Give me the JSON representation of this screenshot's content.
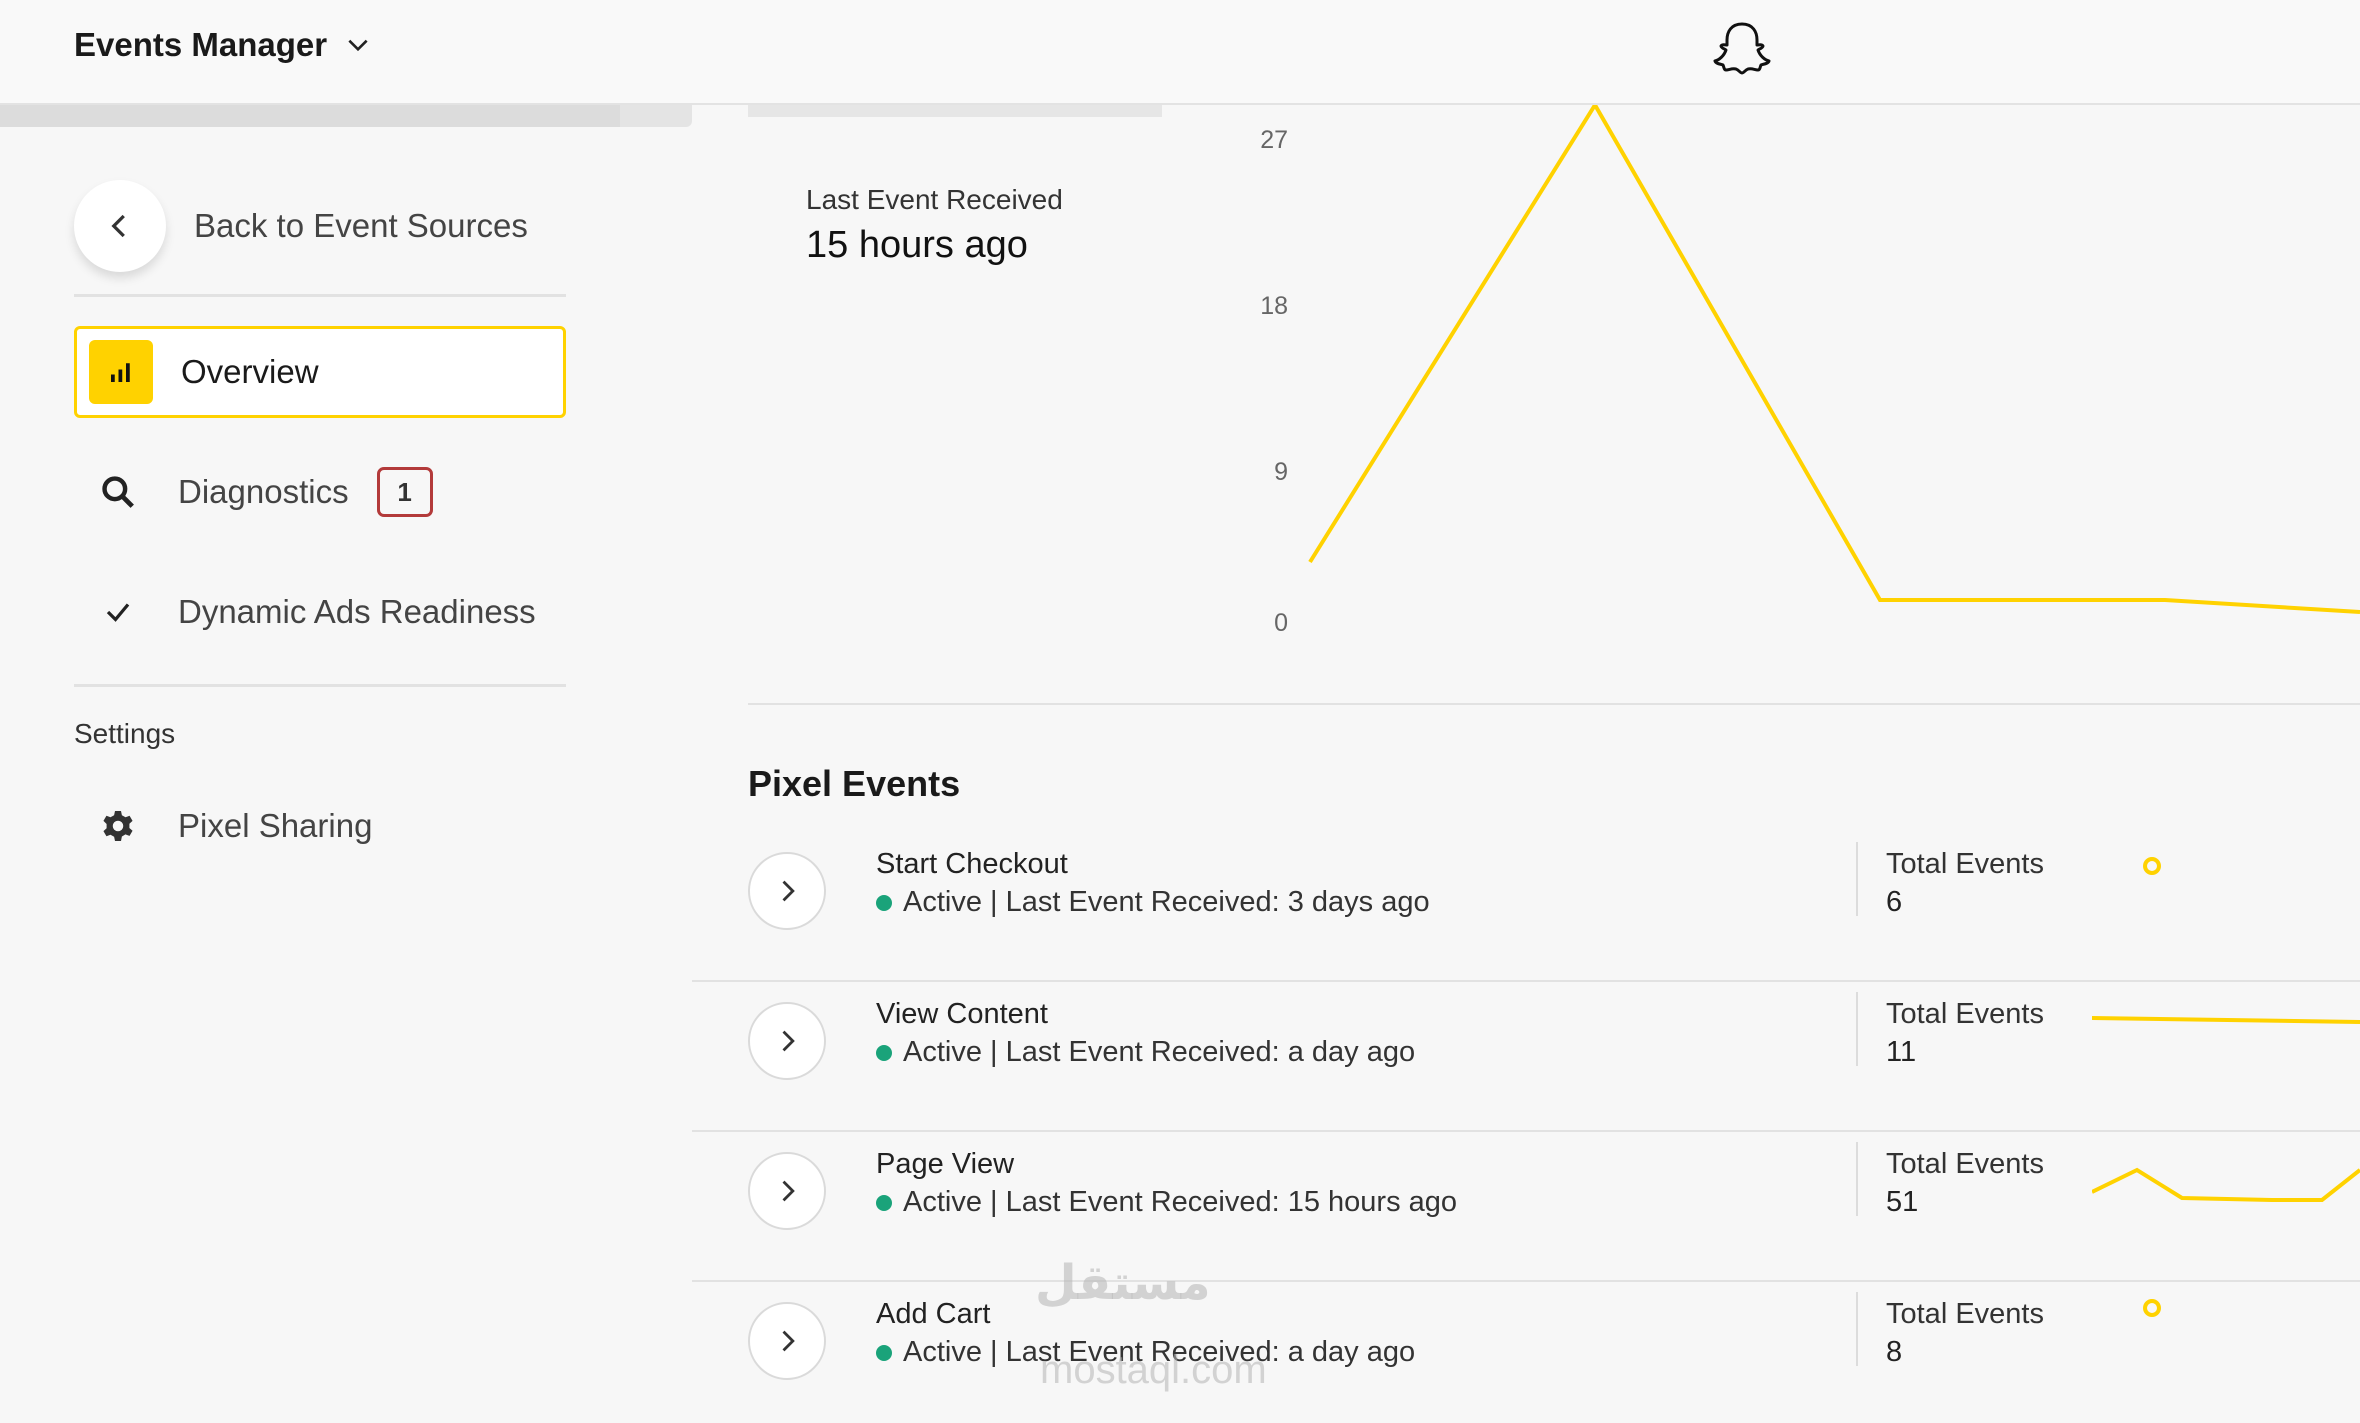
{
  "header": {
    "title": "Events Manager"
  },
  "sidebar": {
    "back_label": "Back to Event Sources",
    "nav": [
      {
        "label": "Overview",
        "icon": "bar-chart-icon",
        "active": true
      },
      {
        "label": "Diagnostics",
        "icon": "search-icon",
        "badge": "1"
      },
      {
        "label": "Dynamic Ads Readiness",
        "icon": "check-icon"
      }
    ],
    "settings_label": "Settings",
    "settings_items": [
      {
        "label": "Pixel Sharing",
        "icon": "gear-icon"
      }
    ]
  },
  "summary": {
    "last_event_label": "Last Event Received",
    "last_event_value": "15 hours ago"
  },
  "chart_data": {
    "type": "line",
    "y_ticks": [
      "27",
      "18",
      "9",
      "0"
    ],
    "ylim": [
      0,
      27
    ],
    "series": [
      {
        "values": [
          4,
          27,
          1,
          1,
          0.5
        ],
        "color": "#ffd200"
      }
    ]
  },
  "pixel_events": {
    "title": "Pixel Events",
    "items": [
      {
        "name": "Start Checkout",
        "status": "Active | Last Event Received: 3 days ago",
        "total_label": "Total Events",
        "total": "6"
      },
      {
        "name": "View Content",
        "status": "Active | Last Event Received: a day ago",
        "total_label": "Total Events",
        "total": "11"
      },
      {
        "name": "Page View",
        "status": "Active | Last Event Received: 15 hours ago",
        "total_label": "Total Events",
        "total": "51"
      },
      {
        "name": "Add Cart",
        "status": "Active | Last Event Received: a day ago",
        "total_label": "Total Events",
        "total": "8"
      }
    ]
  },
  "watermark": {
    "arabic": "مستقل",
    "latin": "mostaql.com"
  },
  "colors": {
    "accent": "#ffd200",
    "active_dot": "#1aa37a",
    "badge_border": "#b33a3a"
  }
}
